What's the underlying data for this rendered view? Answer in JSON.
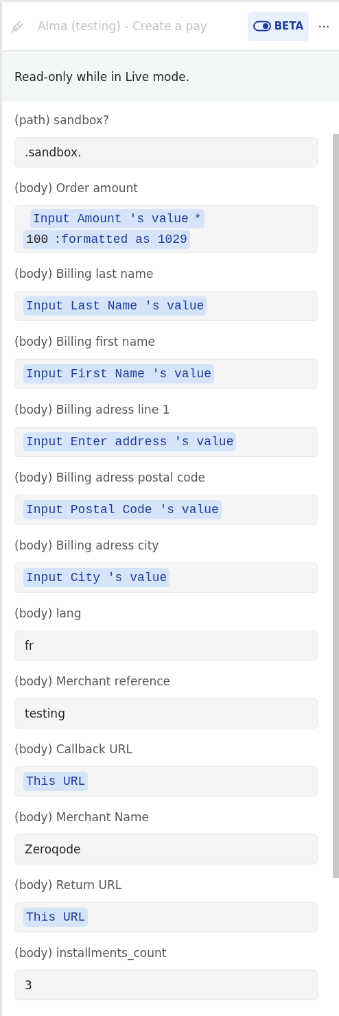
{
  "header": {
    "title": "Alma (testing) - Create a pay",
    "badge": {
      "label": "BETA",
      "on": true
    },
    "menu": "···"
  },
  "banner": "Read-only while in Live mode.",
  "fields": [
    {
      "label": "(path) sandbox?",
      "kind": "plain",
      "value": ".sandbox."
    },
    {
      "label": "(body) Order amount",
      "kind": "expression",
      "lines": [
        [
          {
            "kind": "ref",
            "text": "Input Amount 's value"
          },
          {
            "kind": "ref",
            "text": "*"
          }
        ],
        [
          {
            "kind": "number",
            "text": "100"
          },
          {
            "kind": "ref",
            "text": ":formatted as 1029"
          }
        ]
      ]
    },
    {
      "label": "(body) Billing last name",
      "kind": "expression",
      "lines": [
        [
          {
            "kind": "ref",
            "text": "Input Last Name 's value"
          }
        ]
      ]
    },
    {
      "label": "(body) Billing first name",
      "kind": "expression",
      "lines": [
        [
          {
            "kind": "ref",
            "text": "Input First Name 's value"
          }
        ]
      ]
    },
    {
      "label": "(body) Billing adress line 1",
      "kind": "expression",
      "lines": [
        [
          {
            "kind": "ref",
            "text": "Input Enter address 's value"
          }
        ]
      ]
    },
    {
      "label": "(body) Billing adress postal code",
      "kind": "expression",
      "lines": [
        [
          {
            "kind": "ref",
            "text": "Input Postal Code 's value"
          }
        ]
      ]
    },
    {
      "label": "(body) Billing adress city",
      "kind": "expression",
      "lines": [
        [
          {
            "kind": "ref",
            "text": "Input City 's value"
          }
        ]
      ]
    },
    {
      "label": "(body) lang",
      "kind": "plain",
      "value": "fr"
    },
    {
      "label": "(body) Merchant reference",
      "kind": "plain",
      "value": "testing"
    },
    {
      "label": "(body) Callback URL",
      "kind": "expression",
      "lines": [
        [
          {
            "kind": "ref",
            "text": "This URL"
          }
        ]
      ]
    },
    {
      "label": "(body) Merchant Name",
      "kind": "plain",
      "value": "Zeroqode"
    },
    {
      "label": "(body) Return URL",
      "kind": "expression",
      "lines": [
        [
          {
            "kind": "ref",
            "text": "This URL"
          }
        ]
      ]
    },
    {
      "label": "(body) installments_count",
      "kind": "plain",
      "value": "3"
    }
  ]
}
